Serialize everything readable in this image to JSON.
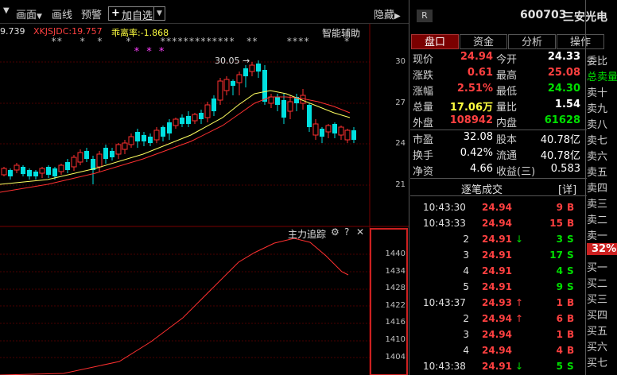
{
  "toolbar": {
    "items": [
      "画面",
      "画线",
      "预警",
      "加自选"
    ],
    "hide_label": "隐藏"
  },
  "indicator": {
    "left_value": "9.739",
    "label": "XKJSJDC:19.757",
    "deviation": "乖离率:-1.868",
    "assist": "智能辅助",
    "stars_row1": "**   *  *    *     *************  **     ****      *",
    "stars_row2": "* * *"
  },
  "main_chart": {
    "peak_label": "30.05",
    "y_ticks": [
      "30",
      "27",
      "24",
      "21"
    ]
  },
  "sub_chart": {
    "title": "主力追踪",
    "y_ticks": [
      "1440",
      "1434",
      "1428",
      "1422",
      "1416",
      "1410",
      "1404"
    ]
  },
  "chart_data": {
    "type": "line",
    "title": "主力追踪",
    "ylim": [
      1400,
      1446
    ],
    "y_ticks": [
      1440,
      1434,
      1428,
      1422,
      1416,
      1410,
      1404
    ]
  },
  "stock": {
    "tag": "R",
    "code": "600703",
    "name": "三安光电"
  },
  "tabs": [
    "盘口",
    "资金",
    "分析",
    "操作"
  ],
  "quote": {
    "rows": [
      {
        "l1": "现价",
        "v1": "24.94",
        "c1": "red",
        "l2": "今开",
        "v2": "24.33",
        "c2": "white"
      },
      {
        "l1": "涨跌",
        "v1": "0.61",
        "c1": "red",
        "l2": "最高",
        "v2": "25.08",
        "c2": "red"
      },
      {
        "l1": "涨幅",
        "v1": "2.51%",
        "c1": "red",
        "l2": "最低",
        "v2": "24.30",
        "c2": "green"
      },
      {
        "l1": "总量",
        "v1": "17.06万",
        "c1": "yellow",
        "l2": "量比",
        "v2": "1.54",
        "c2": "white"
      },
      {
        "l1": "外盘",
        "v1": "108942",
        "c1": "red",
        "l2": "内盘",
        "v2": "61628",
        "c2": "green"
      }
    ],
    "rows2": [
      {
        "l1": "市盈",
        "v1": "32.08",
        "l2": "股本",
        "v2": "40.78亿"
      },
      {
        "l1": "换手",
        "v1": "0.42%",
        "l2": "流通",
        "v2": "40.78亿"
      },
      {
        "l1": "净资",
        "v1": "4.66",
        "l2": "收益(三)",
        "v2": "0.583"
      }
    ]
  },
  "trades": {
    "title": "逐笔成交",
    "detail": "[详]",
    "rows": [
      {
        "time": "10:43:30",
        "seq": "",
        "price": "24.94",
        "arrow": "",
        "vol": "9",
        "bs": "B"
      },
      {
        "time": "10:43:33",
        "seq": "",
        "price": "24.94",
        "arrow": "",
        "vol": "15",
        "bs": "B"
      },
      {
        "time": "",
        "seq": "2",
        "price": "24.91",
        "arrow": "↓",
        "vol": "3",
        "bs": "S"
      },
      {
        "time": "",
        "seq": "3",
        "price": "24.91",
        "arrow": "",
        "vol": "17",
        "bs": "S"
      },
      {
        "time": "",
        "seq": "4",
        "price": "24.91",
        "arrow": "",
        "vol": "4",
        "bs": "S"
      },
      {
        "time": "",
        "seq": "5",
        "price": "24.91",
        "arrow": "",
        "vol": "9",
        "bs": "S"
      },
      {
        "time": "10:43:37",
        "seq": "",
        "price": "24.93",
        "arrow": "↑",
        "vol": "1",
        "bs": "B"
      },
      {
        "time": "",
        "seq": "2",
        "price": "24.94",
        "arrow": "↑",
        "vol": "6",
        "bs": "B"
      },
      {
        "time": "",
        "seq": "3",
        "price": "24.94",
        "arrow": "",
        "vol": "1",
        "bs": "B"
      },
      {
        "time": "",
        "seq": "4",
        "price": "24.94",
        "arrow": "",
        "vol": "4",
        "bs": "B"
      },
      {
        "time": "10:43:38",
        "seq": "",
        "price": "24.91",
        "arrow": "↓",
        "vol": "5",
        "bs": "S"
      }
    ]
  },
  "side": {
    "items": [
      "委比",
      "总卖量",
      "卖十",
      "卖九",
      "卖八",
      "卖七",
      "卖六",
      "卖五",
      "卖四",
      "卖三",
      "卖二",
      "卖一",
      "32%",
      "买一",
      "买二",
      "买三",
      "买四",
      "买五",
      "买六",
      "买七"
    ]
  }
}
